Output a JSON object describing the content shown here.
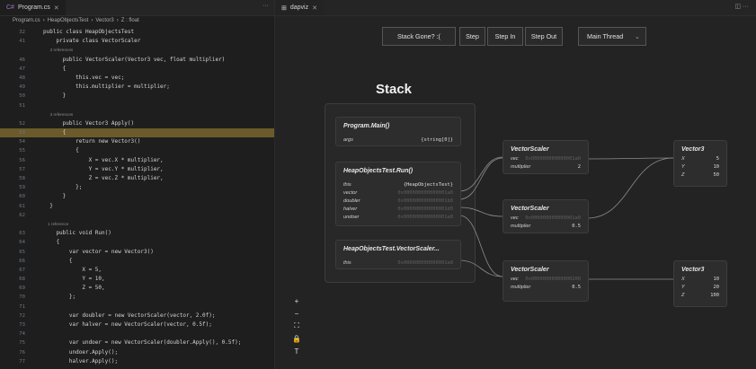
{
  "editor": {
    "tab_label": "Program.cs",
    "breadcrumb": [
      "Program.cs",
      "HeapObjectsTest",
      "Vector3",
      "Z : float"
    ],
    "lines": [
      {
        "n": "32",
        "t": "public class HeapObjectsTest"
      },
      {
        "n": "41",
        "t": "    private class VectorScaler"
      },
      {
        "n": "",
        "t": "      3 references",
        "lens": true
      },
      {
        "n": "46",
        "t": "      public VectorScaler(Vector3 vec, float multiplier)"
      },
      {
        "n": "47",
        "t": "      {"
      },
      {
        "n": "48",
        "t": "          this.vec = vec;"
      },
      {
        "n": "49",
        "t": "          this.multiplier = multiplier;"
      },
      {
        "n": "50",
        "t": "      }"
      },
      {
        "n": "51",
        "t": ""
      },
      {
        "n": "",
        "t": "      3 references",
        "lens": true
      },
      {
        "n": "52",
        "t": "      public Vector3 Apply()"
      },
      {
        "n": "53",
        "t": "      {",
        "hl": true
      },
      {
        "n": "54",
        "t": "          return new Vector3()"
      },
      {
        "n": "55",
        "t": "          {"
      },
      {
        "n": "56",
        "t": "              X = vec.X * multiplier,"
      },
      {
        "n": "57",
        "t": "              Y = vec.Y * multiplier,"
      },
      {
        "n": "58",
        "t": "              Z = vec.Z * multiplier,"
      },
      {
        "n": "59",
        "t": "          };"
      },
      {
        "n": "60",
        "t": "      }"
      },
      {
        "n": "61",
        "t": "  }"
      },
      {
        "n": "62",
        "t": ""
      },
      {
        "n": "",
        "t": "    1 reference",
        "lens": true
      },
      {
        "n": "63",
        "t": "    public void Run()"
      },
      {
        "n": "64",
        "t": "    {"
      },
      {
        "n": "65",
        "t": "        var vector = new Vector3()"
      },
      {
        "n": "66",
        "t": "        {"
      },
      {
        "n": "67",
        "t": "            X = 5,"
      },
      {
        "n": "68",
        "t": "            Y = 10,"
      },
      {
        "n": "69",
        "t": "            Z = 50,"
      },
      {
        "n": "70",
        "t": "        };"
      },
      {
        "n": "71",
        "t": ""
      },
      {
        "n": "72",
        "t": "        var doubler = new VectorScaler(vector, 2.0f);"
      },
      {
        "n": "73",
        "t": "        var halver = new VectorScaler(vector, 0.5f);"
      },
      {
        "n": "74",
        "t": ""
      },
      {
        "n": "75",
        "t": "        var undoer = new VectorScaler(doubler.Apply(), 0.5f);"
      },
      {
        "n": "76",
        "t": "        undoer.Apply();"
      },
      {
        "n": "77",
        "t": "        halver.Apply();"
      }
    ]
  },
  "viz": {
    "tab_label": "dapviz",
    "toolbar": {
      "stack_gone": "Stack Gone? :(",
      "step": "Step",
      "step_in": "Step In",
      "step_out": "Step Out",
      "thread": "Main Thread"
    },
    "stack_title": "Stack",
    "frames": [
      {
        "title": "Program.Main()",
        "rows": [
          {
            "k": "args",
            "v": "{string[0]}"
          }
        ]
      },
      {
        "title": "HeapObjectsTest.Run()",
        "rows": [
          {
            "k": "this",
            "v": "{HeapObjectsTest}"
          },
          {
            "k": "vector",
            "v": "0x000000000000001a0"
          },
          {
            "k": "doubler",
            "v": "0x000000000000001b8"
          },
          {
            "k": "halver",
            "v": "0x000000000000001d0"
          },
          {
            "k": "undoer",
            "v": "0x000000000000001e8"
          }
        ]
      },
      {
        "title": "HeapObjectsTest.VectorScaler...",
        "rows": [
          {
            "k": "this",
            "v": "0x000000000000001e8"
          }
        ]
      }
    ],
    "heap": [
      {
        "title": "VectorScaler",
        "rows": [
          {
            "k": "vec",
            "v": "0x000000000000001a0"
          },
          {
            "k": "multiplier",
            "v": "2"
          }
        ]
      },
      {
        "title": "VectorScaler",
        "rows": [
          {
            "k": "vec",
            "v": "0x000000000000001a0"
          },
          {
            "k": "multiplier",
            "v": "0.5"
          }
        ]
      },
      {
        "title": "VectorScaler",
        "rows": [
          {
            "k": "vec",
            "v": "0x00000000000000200"
          },
          {
            "k": "multiplier",
            "v": "0.5"
          }
        ]
      },
      {
        "title": "Vector3",
        "rows": [
          {
            "k": "X",
            "v": "5"
          },
          {
            "k": "Y",
            "v": "10"
          },
          {
            "k": "Z",
            "v": "50"
          }
        ]
      },
      {
        "title": "Vector3",
        "rows": [
          {
            "k": "X",
            "v": "10"
          },
          {
            "k": "Y",
            "v": "20"
          },
          {
            "k": "Z",
            "v": "100"
          }
        ]
      }
    ],
    "side_tools": [
      "+",
      "−",
      "⛶",
      "🔒",
      "T"
    ]
  }
}
